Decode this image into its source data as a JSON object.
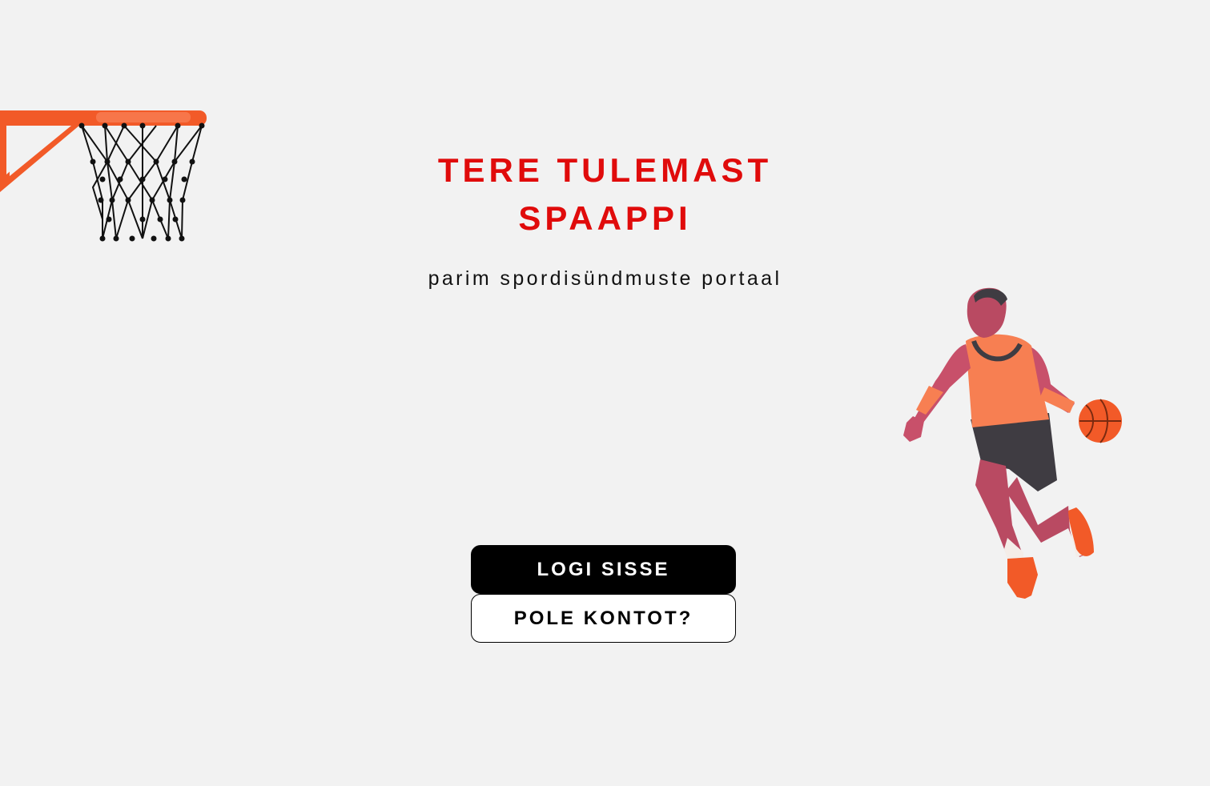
{
  "welcome": {
    "title_line1": "TERE TULEMAST",
    "title_line2": "SPAAPPI",
    "subtitle": "parim spordisündmuste portaal"
  },
  "actions": {
    "login_label": "LOGI SISSE",
    "register_label": "POLE KONTOT?"
  },
  "illustrations": {
    "hoop": "basketball-hoop-icon",
    "player": "basketball-player-icon"
  },
  "colors": {
    "background": "#f2f2f2",
    "accent": "#e00b0b",
    "rim": "#f25a28",
    "login_bg": "#000000",
    "register_bg": "#ffffff"
  }
}
